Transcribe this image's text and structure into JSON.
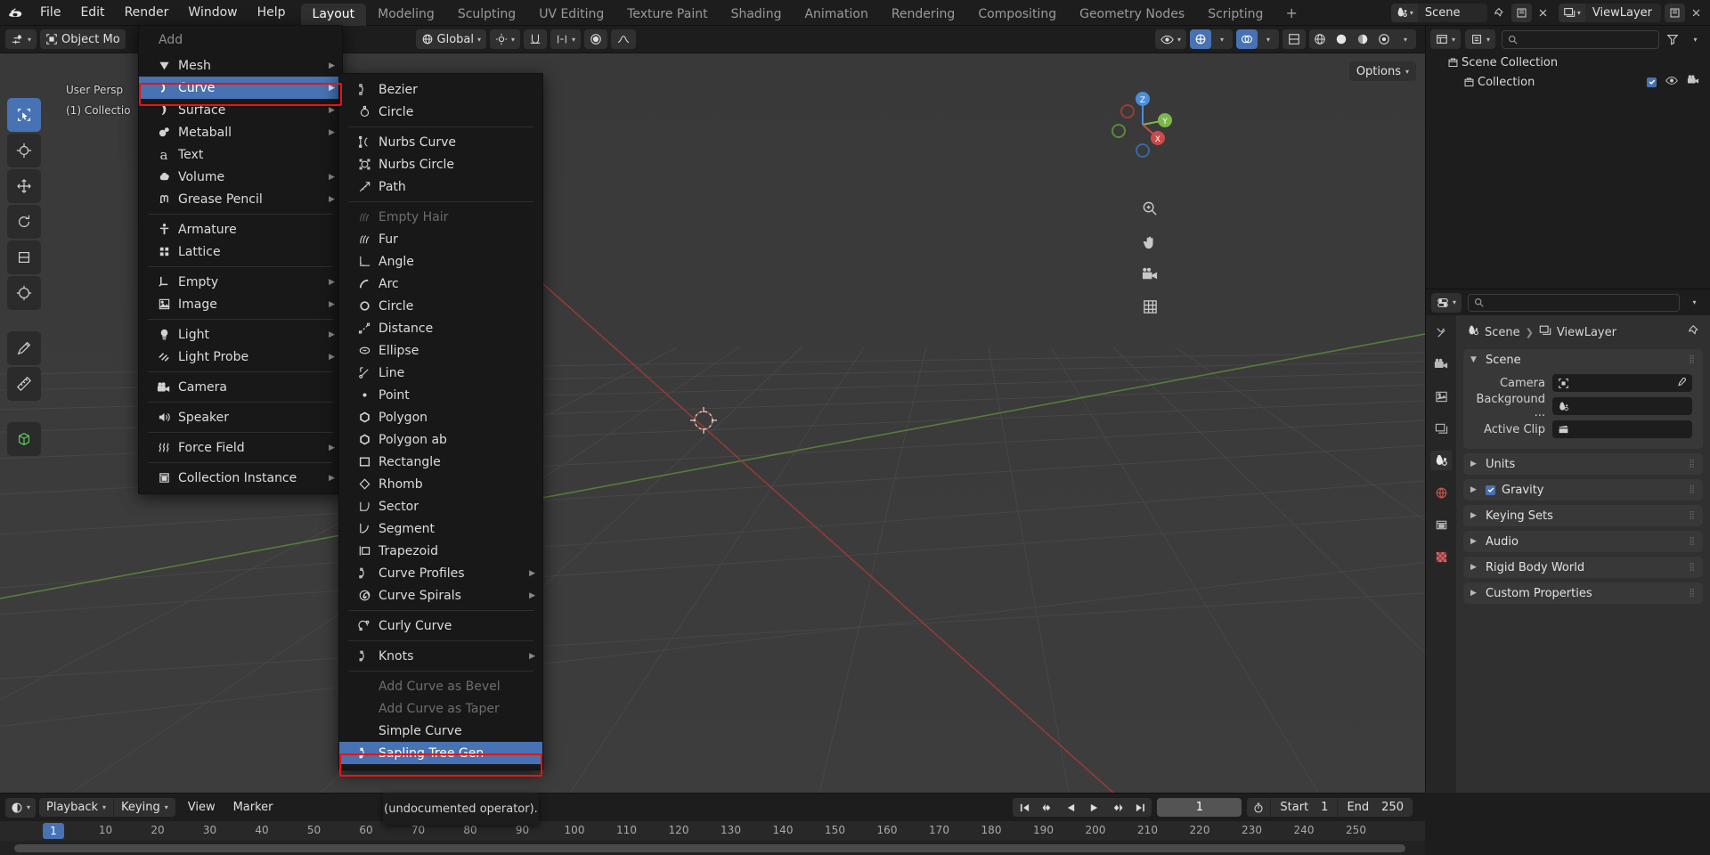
{
  "topbar": {
    "logo_icon": "blender-logo-icon",
    "menus": [
      "File",
      "Edit",
      "Render",
      "Window",
      "Help"
    ],
    "workspaces": [
      {
        "label": "Layout",
        "active": true
      },
      {
        "label": "Modeling",
        "active": false
      },
      {
        "label": "Sculpting",
        "active": false
      },
      {
        "label": "UV Editing",
        "active": false
      },
      {
        "label": "Texture Paint",
        "active": false
      },
      {
        "label": "Shading",
        "active": false
      },
      {
        "label": "Animation",
        "active": false
      },
      {
        "label": "Rendering",
        "active": false
      },
      {
        "label": "Compositing",
        "active": false
      },
      {
        "label": "Geometry Nodes",
        "active": false
      },
      {
        "label": "Scripting",
        "active": false
      }
    ],
    "add_workspace_label": "+",
    "scene_name": "Scene",
    "viewlayer_name": "ViewLayer"
  },
  "viewport_header": {
    "mode_label": "Object Mo",
    "menus_clipped": "ject",
    "transform_orientation": "Global",
    "options_label": "Options"
  },
  "viewport": {
    "view_label": "User Persp",
    "collection_label": "(1) Collectio"
  },
  "add_menu": {
    "title": "Add",
    "items": [
      {
        "label": "Mesh",
        "icon": "mesh-icon",
        "submenu": true,
        "accel": "M"
      },
      {
        "label": "Curve",
        "icon": "curve-icon",
        "submenu": true,
        "selected": true,
        "highlight": true,
        "accel": "C"
      },
      {
        "label": "Surface",
        "icon": "surface-icon",
        "submenu": true,
        "accel": "S"
      },
      {
        "label": "Metaball",
        "icon": "metaball-icon",
        "submenu": true,
        "accel": "b"
      },
      {
        "label": "Text",
        "icon": "text-icon",
        "submenu": false,
        "accel": "T"
      },
      {
        "label": "Volume",
        "icon": "volume-icon",
        "submenu": true,
        "accel": "V"
      },
      {
        "label": "Grease Pencil",
        "icon": "grease-pencil-icon",
        "submenu": true,
        "accel": "G"
      },
      {
        "separator": true
      },
      {
        "label": "Armature",
        "icon": "armature-icon",
        "submenu": false,
        "accel": "A"
      },
      {
        "label": "Lattice",
        "icon": "lattice-icon",
        "submenu": false,
        "accel": "L"
      },
      {
        "separator": true
      },
      {
        "label": "Empty",
        "icon": "empty-axes-icon",
        "submenu": true,
        "accel": "E"
      },
      {
        "label": "Image",
        "icon": "image-icon",
        "submenu": true,
        "accel": "I"
      },
      {
        "separator": true
      },
      {
        "label": "Light",
        "icon": "light-icon",
        "submenu": true,
        "accel": "h"
      },
      {
        "label": "Light Probe",
        "icon": "light-probe-icon",
        "submenu": true,
        "accel": "P"
      },
      {
        "separator": true
      },
      {
        "label": "Camera",
        "icon": "camera-icon",
        "submenu": false,
        "accel": "e"
      },
      {
        "separator": true
      },
      {
        "label": "Speaker",
        "icon": "speaker-icon",
        "submenu": false,
        "accel": "a"
      },
      {
        "separator": true
      },
      {
        "label": "Force Field",
        "icon": "force-field-icon",
        "submenu": true,
        "accel": "F"
      },
      {
        "separator": true
      },
      {
        "label": "Collection Instance",
        "icon": "collection-instance-icon",
        "submenu": true,
        "accel": "C"
      }
    ]
  },
  "curve_menu": {
    "items": [
      {
        "label": "Bezier",
        "icon": "bezier-curve-icon",
        "accel": "B"
      },
      {
        "label": "Circle",
        "icon": "bezier-circle-icon",
        "accel": "C"
      },
      {
        "separator": true
      },
      {
        "label": "Nurbs Curve",
        "icon": "nurbs-curve-icon",
        "accel": "N"
      },
      {
        "label": "Nurbs Circle",
        "icon": "nurbs-circle-icon",
        "accel": "u"
      },
      {
        "label": "Path",
        "icon": "path-icon",
        "accel": "P"
      },
      {
        "separator": true
      },
      {
        "label": "Empty Hair",
        "icon": "empty-hair-icon",
        "disabled": true,
        "accel": "E"
      },
      {
        "label": "Fur",
        "icon": "fur-icon",
        "accel": "F"
      },
      {
        "label": "Angle",
        "icon": "angle-icon",
        "accel": "A"
      },
      {
        "label": "Arc",
        "icon": "arc-icon",
        "accel": ""
      },
      {
        "label": "Circle",
        "icon": "circle-shape-icon",
        "accel": "r"
      },
      {
        "label": "Distance",
        "icon": "distance-icon",
        "accel": "D"
      },
      {
        "label": "Ellipse",
        "icon": "ellipse-icon",
        "accel": ""
      },
      {
        "label": "Line",
        "icon": "line-icon",
        "accel": "L"
      },
      {
        "label": "Point",
        "icon": "point-icon",
        "accel": "o"
      },
      {
        "label": "Polygon",
        "icon": "polygon-icon",
        "accel": "g"
      },
      {
        "label": "Polygon ab",
        "icon": "polygon-ab-icon",
        "accel": ""
      },
      {
        "label": "Rectangle",
        "icon": "rectangle-icon",
        "accel": "R"
      },
      {
        "label": "Rhomb",
        "icon": "rhomb-icon",
        "accel": "h"
      },
      {
        "label": "Sector",
        "icon": "sector-icon",
        "accel": "S"
      },
      {
        "label": "Segment",
        "icon": "segment-icon",
        "accel": "m"
      },
      {
        "label": "Trapezoid",
        "icon": "trapezoid-icon",
        "accel": "T"
      },
      {
        "label": "Curve Profiles",
        "icon": "curve-profiles-icon",
        "submenu": true,
        "accel": "v"
      },
      {
        "label": "Curve Spirals",
        "icon": "curve-spirals-icon",
        "submenu": true,
        "accel": ""
      },
      {
        "separator": true
      },
      {
        "label": "Curly Curve",
        "icon": "curly-curve-icon",
        "accel": ""
      },
      {
        "separator": true
      },
      {
        "label": "Knots",
        "icon": "knots-icon",
        "submenu": true,
        "accel": "K"
      },
      {
        "separator": true
      },
      {
        "label": "Add Curve as Bevel",
        "icon": "",
        "disabled": true
      },
      {
        "label": "Add Curve as Taper",
        "icon": "",
        "disabled": true
      },
      {
        "label": "Simple Curve",
        "icon": ""
      },
      {
        "label": "Sapling Tree Gen",
        "icon": "sapling-tree-icon",
        "selected": true,
        "highlight": true,
        "accel": "G"
      }
    ]
  },
  "outliner": {
    "search_placeholder": "",
    "rows": [
      {
        "label": "Scene Collection",
        "icon": "scene-collection-icon",
        "indent": 0
      },
      {
        "label": "Collection",
        "icon": "collection-icon",
        "indent": 1,
        "checked": true
      }
    ]
  },
  "properties": {
    "search_placeholder": "",
    "breadcrumb": [
      {
        "label": "Scene",
        "icon": "scene-icon"
      },
      {
        "label": "ViewLayer",
        "icon": "viewlayer-icon"
      }
    ],
    "tabs": [
      "tool-icon",
      "render-icon",
      "output-icon",
      "viewlayer-props-icon",
      "scene-props-icon",
      "world-icon",
      "collection-props-icon",
      "texture-icon"
    ],
    "active_tab_index": 4,
    "panels": [
      {
        "label": "Scene",
        "open": true
      },
      {
        "label": "Units",
        "open": false
      },
      {
        "label": "Gravity",
        "open": false,
        "checkbox": true,
        "checked": true
      },
      {
        "label": "Keying Sets",
        "open": false
      },
      {
        "label": "Audio",
        "open": false
      },
      {
        "label": "Rigid Body World",
        "open": false
      },
      {
        "label": "Custom Properties",
        "open": false
      }
    ],
    "scene_fields": [
      {
        "label": "Camera",
        "value": "",
        "icon": "camera-data-icon",
        "eyedropper": true
      },
      {
        "label": "Background ...",
        "value": "",
        "icon": "scene-icon",
        "eyedropper": false
      },
      {
        "label": "Active Clip",
        "value": "",
        "icon": "clip-icon",
        "eyedropper": false
      }
    ]
  },
  "timeline": {
    "menus": [
      {
        "label": "Playback",
        "dropdown": true
      },
      {
        "label": "Keying",
        "dropdown": true
      },
      {
        "label": "View",
        "dropdown": false
      },
      {
        "label": "Marker",
        "dropdown": false
      }
    ],
    "current_frame": "1",
    "start_label": "Start",
    "start_value": "1",
    "end_label": "End",
    "end_value": "250",
    "ticks": [
      10,
      20,
      30,
      40,
      50,
      60,
      70,
      80,
      90,
      100,
      110,
      120,
      130,
      140,
      150,
      160,
      170,
      180,
      190,
      200,
      210,
      220,
      230,
      240,
      250
    ],
    "playhead_label": "1",
    "tooltip_text": "(undocumented operator)."
  },
  "colors": {
    "accent_blue": "#4772b3",
    "highlight_red": "#ee1111",
    "bg_dark": "#1d1d1d",
    "bg_viewport": "#393939",
    "menu_bg": "#181818",
    "axis_x_red": "#a33b3b",
    "axis_y_green": "#5a8a3c"
  }
}
